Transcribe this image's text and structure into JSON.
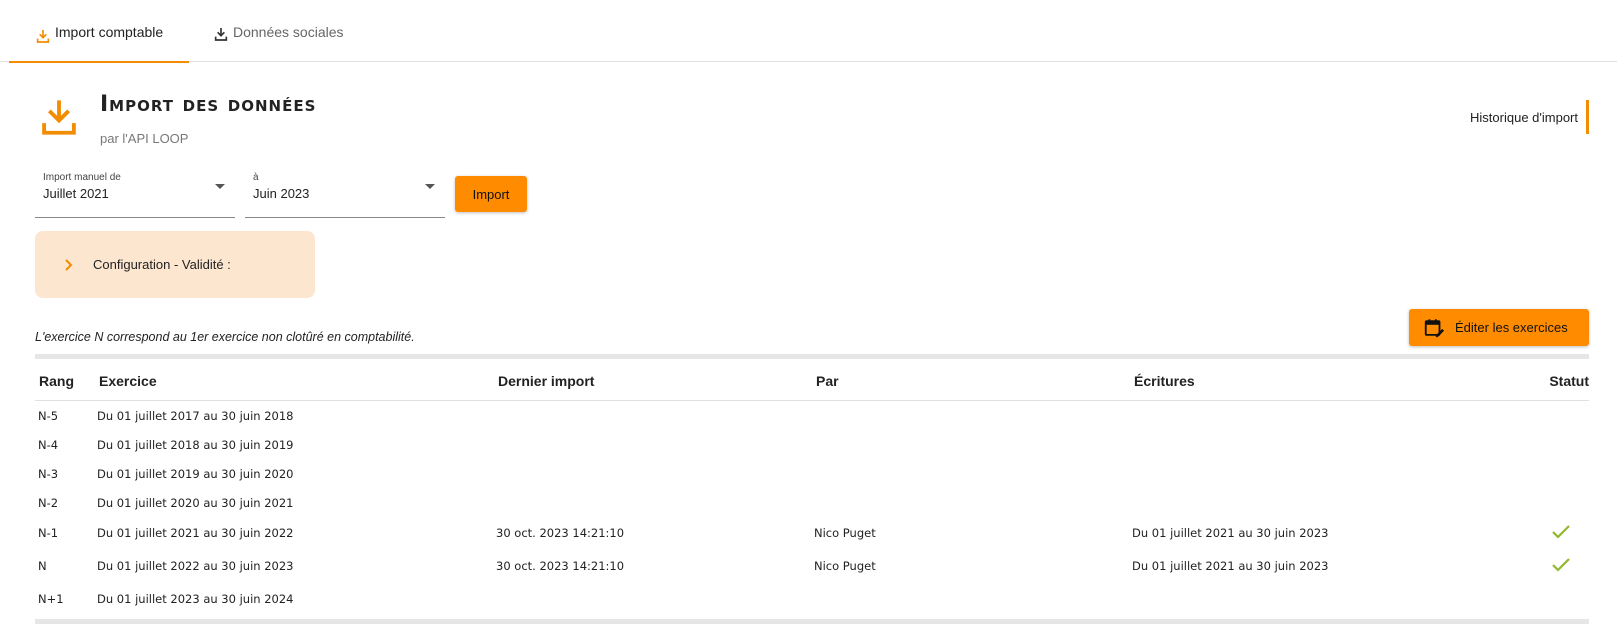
{
  "tabs": [
    {
      "label": "Import comptable",
      "active": true,
      "icon": "download-icon"
    },
    {
      "label": "Données sociales",
      "active": false,
      "icon": "download-icon"
    }
  ],
  "header": {
    "title": "Import des données",
    "subtitle": "par l'API LOOP",
    "icon": "download-icon",
    "history_link": "Historique d'import"
  },
  "filters": {
    "from": {
      "label": "Import manuel de",
      "value": "Juillet 2021"
    },
    "to": {
      "label": "à",
      "value": "Juin 2023"
    },
    "import_button": "Import"
  },
  "config": {
    "label": "Configuration - Validité :"
  },
  "note": "L'exercice N correspond au 1er exercice non clotûré en comptabilité.",
  "edit_button": "Éditer les exercices",
  "table": {
    "headers": {
      "rang": "Rang",
      "exercice": "Exercice",
      "dernier_import": "Dernier import",
      "par": "Par",
      "ecritures": "Écritures",
      "statut": "Statut"
    },
    "rows": [
      {
        "rang": "N-5",
        "exercice": "Du 01 juillet 2017 au 30 juin 2018",
        "dernier_import": "",
        "par": "",
        "ecritures": "",
        "statut": ""
      },
      {
        "rang": "N-4",
        "exercice": "Du 01 juillet 2018 au 30 juin 2019",
        "dernier_import": "",
        "par": "",
        "ecritures": "",
        "statut": ""
      },
      {
        "rang": "N-3",
        "exercice": "Du 01 juillet 2019 au 30 juin 2020",
        "dernier_import": "",
        "par": "",
        "ecritures": "",
        "statut": ""
      },
      {
        "rang": "N-2",
        "exercice": "Du 01 juillet 2020 au 30 juin 2021",
        "dernier_import": "",
        "par": "",
        "ecritures": "",
        "statut": ""
      },
      {
        "rang": "N-1",
        "exercice": "Du 01 juillet 2021 au 30 juin 2022",
        "dernier_import": "30 oct. 2023 14:21:10",
        "par": "Nico Puget",
        "ecritures": "Du 01 juillet 2021 au 30 juin 2023",
        "statut": "check"
      },
      {
        "rang": "N",
        "exercice": "Du 01 juillet 2022 au 30 juin 2023",
        "dernier_import": "30 oct. 2023 14:21:10",
        "par": "Nico Puget",
        "ecritures": "Du 01 juillet 2021 au 30 juin 2023",
        "statut": "check"
      },
      {
        "rang": "N+1",
        "exercice": "Du 01 juillet 2023 au 30 juin 2024",
        "dernier_import": "",
        "par": "",
        "ecritures": "",
        "statut": ""
      }
    ]
  },
  "colors": {
    "accent": "#ff8c00",
    "config_bg": "#fde6cf",
    "check": "#8fb82a"
  }
}
